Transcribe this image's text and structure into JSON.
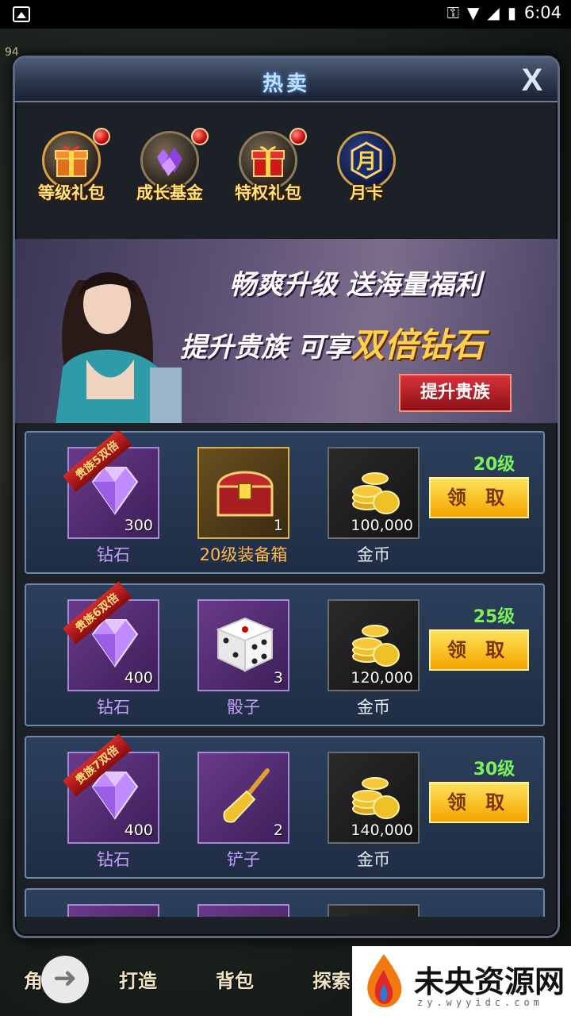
{
  "status_bar": {
    "time": "6:04"
  },
  "hud": {
    "player_level": "94"
  },
  "dialog": {
    "title": "热卖",
    "close_label": "X"
  },
  "categories": [
    {
      "label": "等级礼包",
      "icon": "gift-box-icon",
      "has_badge": true
    },
    {
      "label": "成长基金",
      "icon": "purple-gems-icon",
      "has_badge": true
    },
    {
      "label": "特权礼包",
      "icon": "red-gift-icon",
      "has_badge": true
    },
    {
      "label": "月卡",
      "icon": "month-card-icon",
      "has_badge": false
    }
  ],
  "banner": {
    "slogan_line1": "畅爽升级 送海量福利",
    "slogan_line2_prefix": "提升贵族 可享",
    "slogan_line2_highlight": "双倍钻石",
    "button_label": "提升贵族"
  },
  "rewards": [
    {
      "level": "20级",
      "claim_label": "领 取",
      "items": [
        {
          "name": "钻石",
          "qty": "300",
          "ribbon": "贵族5双倍",
          "kind": "gem"
        },
        {
          "name": "20级装备箱",
          "qty": "1",
          "kind": "chest"
        },
        {
          "name": "金币",
          "qty": "100,000",
          "kind": "coins"
        }
      ]
    },
    {
      "level": "25级",
      "claim_label": "领 取",
      "items": [
        {
          "name": "钻石",
          "qty": "400",
          "ribbon": "贵族6双倍",
          "kind": "gem"
        },
        {
          "name": "骰子",
          "qty": "3",
          "kind": "dice"
        },
        {
          "name": "金币",
          "qty": "120,000",
          "kind": "coins"
        }
      ]
    },
    {
      "level": "30级",
      "claim_label": "领 取",
      "items": [
        {
          "name": "钻石",
          "qty": "400",
          "ribbon": "贵族7双倍",
          "kind": "gem"
        },
        {
          "name": "铲子",
          "qty": "2",
          "kind": "shovel"
        },
        {
          "name": "金币",
          "qty": "140,000",
          "kind": "coins"
        }
      ]
    }
  ],
  "bottom_menu": {
    "items": [
      "角色",
      "打造",
      "背包",
      "探索"
    ]
  },
  "watermark": {
    "text": "未央资源网",
    "sub": "zy.wyyidc.com"
  }
}
